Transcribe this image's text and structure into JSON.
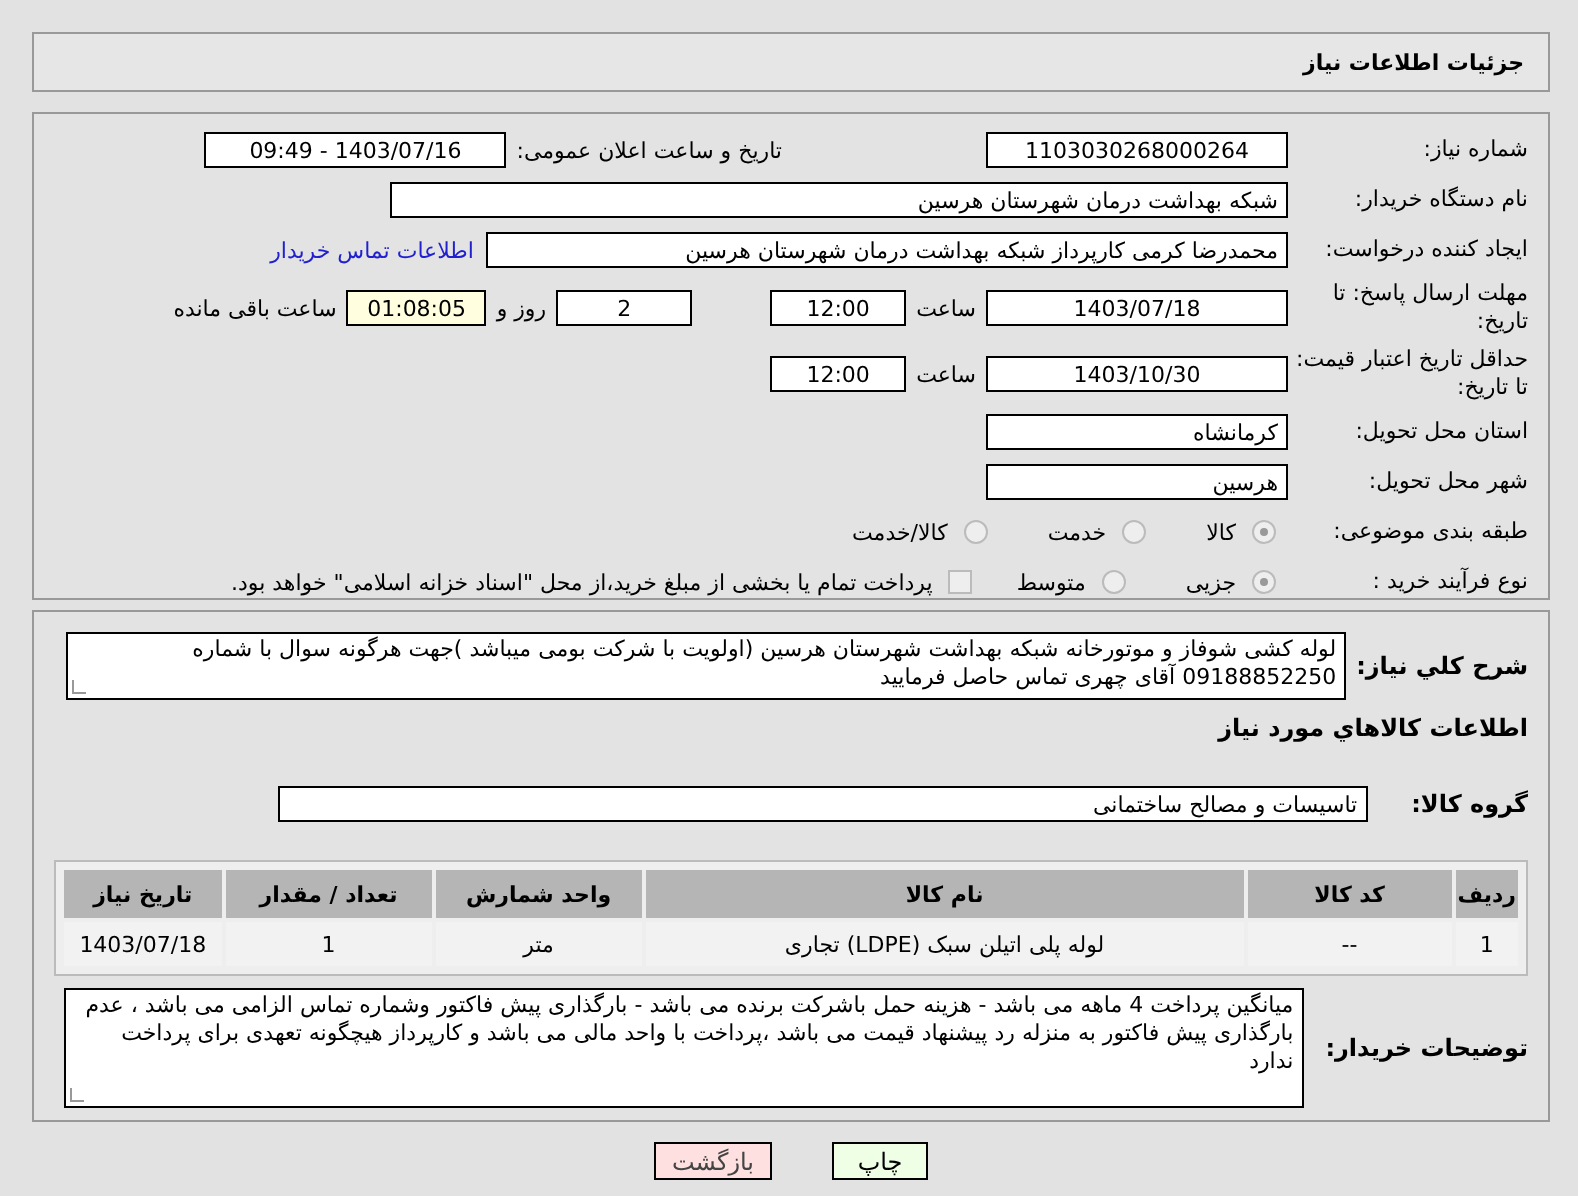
{
  "page_title": "جزئیات اطلاعات نیاز",
  "need_number": {
    "label": "شماره نیاز:",
    "value": "1103030268000264",
    "announce_label": "تاریخ و ساعت اعلان عمومی:",
    "announce_value": "1403/07/16 - 09:49"
  },
  "buyer_org": {
    "label": "نام دستگاه خریدار:",
    "value": "شبکه بهداشت درمان شهرستان هرسین"
  },
  "requester": {
    "label": "ایجاد کننده درخواست:",
    "value": "محمدرضا کرمی کارپرداز شبکه بهداشت درمان شهرستان هرسین",
    "link": "اطلاعات تماس خریدار"
  },
  "reply_deadline": {
    "label": "مهلت ارسال پاسخ: تا تاریخ:",
    "date": "1403/07/18",
    "time_label": "ساعت",
    "time": "12:00",
    "days": "2",
    "days_label": "روز و",
    "remaining": "01:08:05",
    "remaining_label": "ساعت باقی مانده"
  },
  "price_validity": {
    "label": "حداقل تاریخ اعتبار قیمت: تا تاریخ:",
    "date": "1403/10/30",
    "time_label": "ساعت",
    "time": "12:00"
  },
  "province": {
    "label": "استان محل تحویل:",
    "value": "کرمانشاه"
  },
  "city": {
    "label": "شهر محل تحویل:",
    "value": "هرسین"
  },
  "category": {
    "label": "طبقه بندی موضوعی:",
    "options": [
      {
        "label": "کالا",
        "selected": true
      },
      {
        "label": "خدمت",
        "selected": false
      },
      {
        "label": "کالا/خدمت",
        "selected": false
      }
    ]
  },
  "process": {
    "label": "نوع فرآیند خرید :",
    "options": [
      {
        "label": "جزیی",
        "selected": true
      },
      {
        "label": "متوسط",
        "selected": false
      }
    ],
    "payment": {
      "checked": false,
      "text": "پرداخت تمام یا بخشی از مبلغ خرید،از محل \"اسناد خزانه اسلامی\" خواهد بود."
    }
  },
  "description": {
    "label": "شرح کلي نياز:",
    "text": "لوله کشی شوفاز و موتورخانه شبکه بهداشت شهرستان هرسین (اولویت با شرکت بومی میباشد )جهت هرگونه سوال با شماره 09188852250 آقای چهری تماس حاصل فرمایید"
  },
  "goods": {
    "heading": "اطلاعات کالاهاي مورد نياز",
    "group_label": "گروه کالا:",
    "group_value": "تاسیسات و مصالح ساختمانی",
    "table": {
      "columns": [
        "ردیف",
        "کد کالا",
        "نام کالا",
        "واحد شمارش",
        "تعداد / مقدار",
        "تاریخ نیاز"
      ],
      "rows": [
        [
          "1",
          "--",
          "لوله پلی اتیلن سبک (LDPE) تجاری",
          "متر",
          "1",
          "1403/07/18"
        ]
      ]
    }
  },
  "buyer_notes": {
    "label": "توضیحات خریدار:",
    "text": "میانگین پرداخت 4 ماهه می باشد - هزینه حمل باشرکت برنده می باشد - بارگذاری پیش فاکتور وشماره تماس الزامی می باشد ، عدم بارگذاری پیش فاکتور به منزله رد پیشنهاد قیمت می باشد ،پرداخت با واحد مالی می باشد و کارپرداز هیچگونه تعهدی برای پرداخت ندارد"
  },
  "buttons": [
    {
      "label": "چاپ",
      "kind": "print"
    },
    {
      "label": "بازگشت",
      "kind": "back"
    }
  ]
}
